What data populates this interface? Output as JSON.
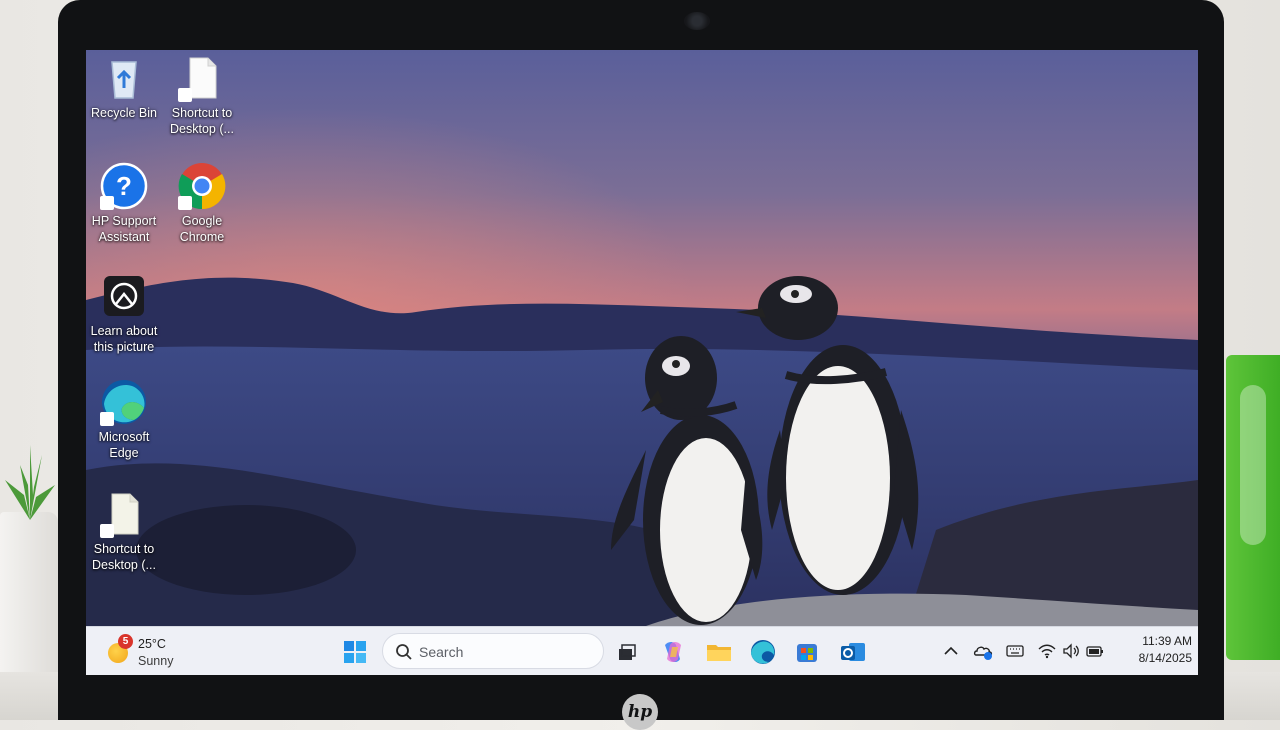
{
  "desktop": {
    "icons": [
      {
        "label": "Recycle Bin"
      },
      {
        "label": "Shortcut to Desktop (..."
      },
      {
        "label": "HP Support Assistant"
      },
      {
        "label": "Google Chrome"
      },
      {
        "label": "Learn about this picture"
      },
      {
        "label": "Microsoft Edge"
      },
      {
        "label": "Shortcut to Desktop (..."
      }
    ]
  },
  "taskbar": {
    "weather": {
      "temperature": "25°C",
      "condition": "Sunny",
      "badge": "5"
    },
    "search": {
      "placeholder": "Search"
    },
    "pinned_apps": [
      "start-icon",
      "task-view-icon",
      "copilot-icon",
      "file-explorer-icon",
      "edge-icon",
      "microsoft-store-icon",
      "outlook-icon"
    ],
    "tray": {
      "icons": [
        "chevron-up-icon",
        "onedrive-icon",
        "keyboard-icon",
        "wifi-icon",
        "volume-icon",
        "battery-icon"
      ],
      "time": "11:39 AM",
      "date": "8/14/2025"
    }
  },
  "device": {
    "brand": "hp"
  }
}
